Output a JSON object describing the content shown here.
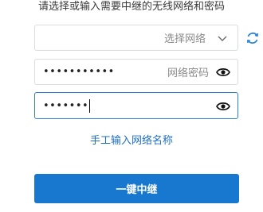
{
  "title": "请选择或输入需要中继的无线网络和密码",
  "ssid": {
    "placeholder": "选择网络"
  },
  "password": {
    "masked_value": "•••••••••••",
    "placeholder": "网络密码"
  },
  "confirm_password": {
    "masked_value": "•••••••"
  },
  "manual_link_label": "手工输入网络名称",
  "repeat_button_label": "一键中继",
  "colors": {
    "accent": "#1878d0",
    "link": "#1f6fbf",
    "focus_border": "#2f7fcf"
  },
  "icons": [
    "chevron-down-icon",
    "refresh-icon",
    "eye-icon"
  ]
}
